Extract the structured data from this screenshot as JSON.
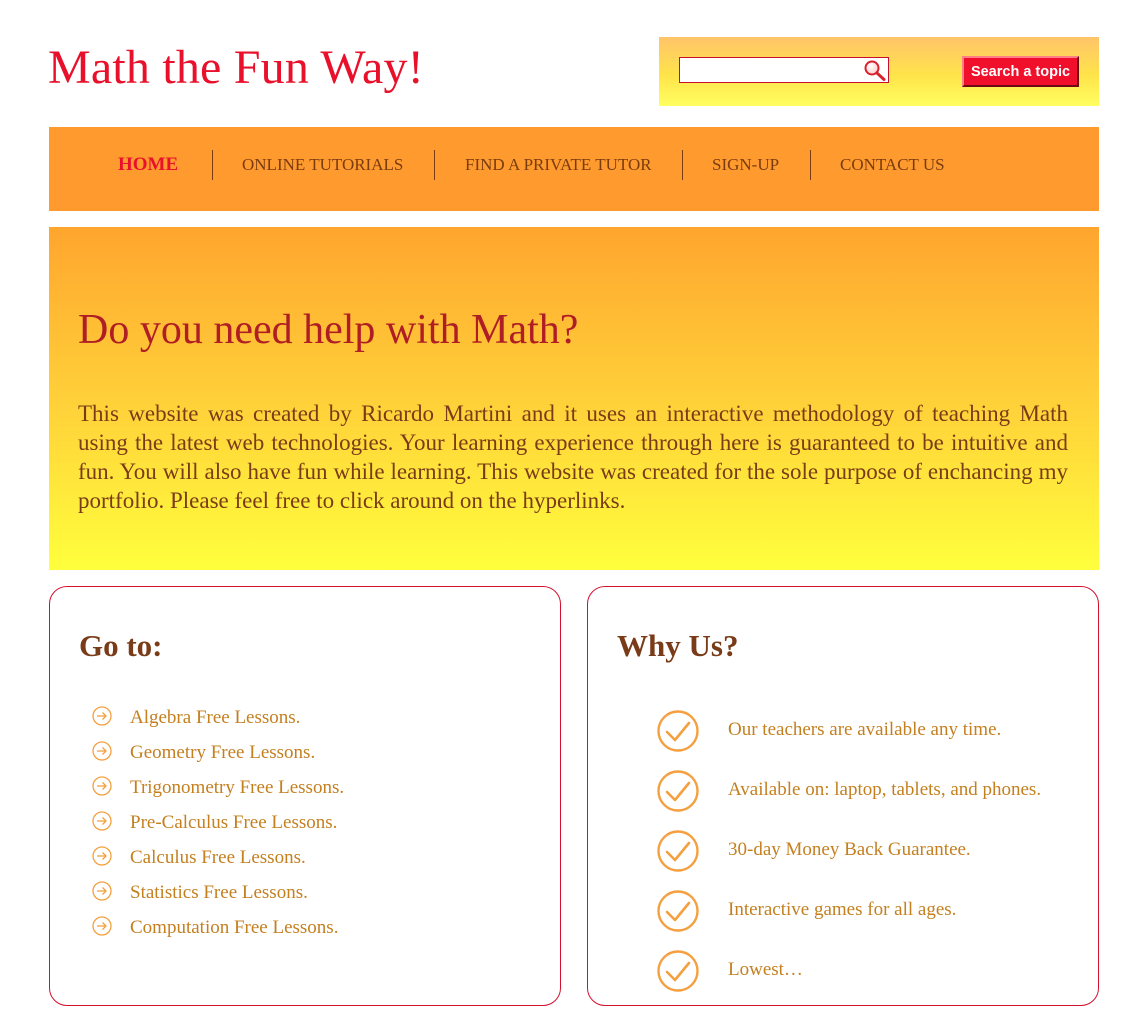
{
  "header": {
    "title": "Math the Fun Way!"
  },
  "search": {
    "placeholder": "",
    "value": "",
    "button_label": "Search a topic"
  },
  "nav": {
    "items": [
      {
        "label": "HOME",
        "active": true
      },
      {
        "label": "ONLINE TUTORIALS"
      },
      {
        "label": "FIND A PRIVATE TUTOR"
      },
      {
        "label": "SIGN-UP"
      },
      {
        "label": "CONTACT US"
      }
    ]
  },
  "hero": {
    "title": "Do you need help with Math?",
    "text": "This website was created by Ricardo Martini and it uses an interactive methodology of teaching Math using the latest web technologies. Your learning experience through here is guaranteed to be intuitive and fun. You will also have fun while learning. This website was created for the sole purpose of enchancing my portfolio. Please feel free to click around on the hyperlinks."
  },
  "goto": {
    "title": "Go to:",
    "items": [
      "Algebra Free Lessons.",
      "Geometry Free Lessons.",
      "Trigonometry Free Lessons.",
      "Pre-Calculus Free Lessons.",
      "Calculus Free Lessons.",
      "Statistics Free Lessons.",
      "Computation Free Lessons."
    ]
  },
  "why": {
    "title": "Why Us?",
    "items": [
      "Our teachers are available any time.",
      "Available on: laptop, tablets, and phones.",
      "30-day Money Back Guarantee.",
      "Interactive games for all ages.",
      "Lowest…"
    ]
  },
  "colors": {
    "brand_red": "#e8102b",
    "nav_orange": "#ff9b2e",
    "text_brown": "#7a3b18",
    "link_gold": "#c47f1f",
    "icon_orange": "#f4a040"
  },
  "icons": {
    "search": "magnifier-icon",
    "goto_bullet": "circle-arrow-right-icon",
    "why_bullet": "circle-check-icon"
  }
}
